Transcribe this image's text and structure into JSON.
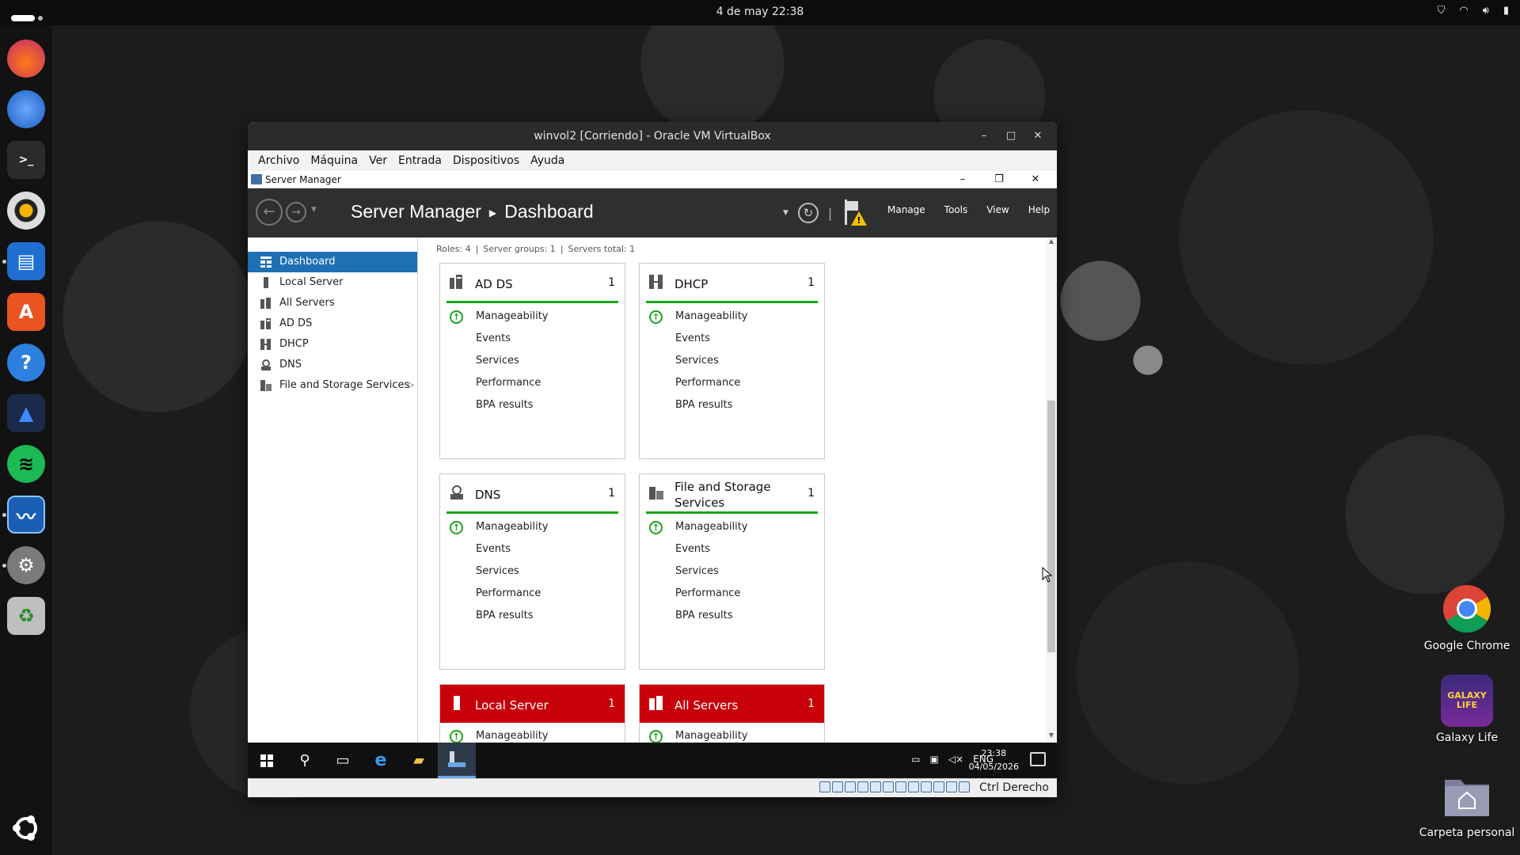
{
  "desktop": {
    "topbar": {
      "clock": "4 de may  22:38"
    },
    "icons": [
      {
        "label": "Google Chrome"
      },
      {
        "label": "Galaxy Life",
        "logo_text": "GALAXY LIFE"
      },
      {
        "label": "Carpeta personal"
      }
    ]
  },
  "vbox": {
    "title": "winvol2 [Corriendo] - Oracle VM VirtualBox",
    "menu": [
      "Archivo",
      "Máquina",
      "Ver",
      "Entrada",
      "Dispositivos",
      "Ayuda"
    ],
    "status_host_key": "Ctrl Derecho"
  },
  "server_manager": {
    "window_title": "Server Manager",
    "breadcrumb": {
      "app": "Server Manager",
      "page": "Dashboard"
    },
    "menu": [
      "Manage",
      "Tools",
      "View",
      "Help"
    ],
    "sidebar": [
      {
        "label": "Dashboard",
        "icon": "dashboard-icon",
        "active": true
      },
      {
        "label": "Local Server",
        "icon": "local-server-icon"
      },
      {
        "label": "All Servers",
        "icon": "all-servers-icon"
      },
      {
        "label": "AD DS",
        "icon": "ad-ds-icon"
      },
      {
        "label": "DHCP",
        "icon": "dhcp-icon"
      },
      {
        "label": "DNS",
        "icon": "dns-icon"
      },
      {
        "label": "File and Storage Services",
        "icon": "file-storage-icon",
        "has_submenu": true
      }
    ],
    "summary": {
      "roles": "Roles: 4",
      "groups": "Server groups: 1",
      "total": "Servers total: 1"
    },
    "tiles": [
      {
        "name": "AD DS",
        "count": "1",
        "rows": [
          "Manageability",
          "Events",
          "Services",
          "Performance",
          "BPA results"
        ]
      },
      {
        "name": "DHCP",
        "count": "1",
        "rows": [
          "Manageability",
          "Events",
          "Services",
          "Performance",
          "BPA results"
        ]
      },
      {
        "name": "DNS",
        "count": "1",
        "rows": [
          "Manageability",
          "Events",
          "Services",
          "Performance",
          "BPA results"
        ]
      },
      {
        "name": "File and Storage Services",
        "count": "1",
        "rows": [
          "Manageability",
          "Events",
          "Services",
          "Performance",
          "BPA results"
        ]
      },
      {
        "name": "Local Server",
        "count": "1",
        "rows": [
          "Manageability"
        ],
        "alert": true
      },
      {
        "name": "All Servers",
        "count": "1",
        "rows": [
          "Manageability"
        ],
        "alert": true
      }
    ],
    "colors": {
      "accent": "#1f6fb5",
      "ok": "#1aa51a",
      "alert": "#c8000a"
    }
  },
  "guest_taskbar": {
    "lang": "ENG",
    "time": "23:38",
    "date": "04/05/2026"
  }
}
